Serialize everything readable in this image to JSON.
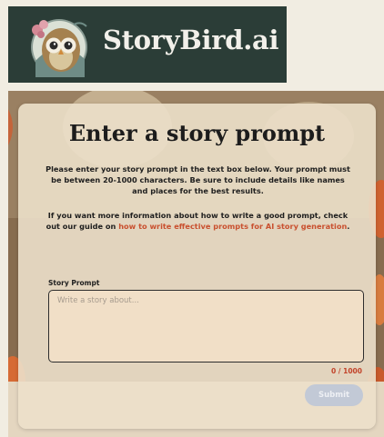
{
  "brand": {
    "name": "StoryBird.ai",
    "logo_icon": "owl-logo-icon",
    "bar_color": "#2b3d37"
  },
  "card": {
    "title": "Enter a story prompt",
    "description": "Please enter your story prompt in the text box below. Your prompt must be between 20-1000 characters. Be sure to include details like names and places for the best results.",
    "guide_prefix": "If you want more information about how to write a good prompt, check out our guide on",
    "guide_link": "how to write effective prompts for AI story generation",
    "guide_suffix": "."
  },
  "prompt_field": {
    "label": "Story Prompt",
    "placeholder": "Write a story about...",
    "value": "",
    "char_count": "0 / 1000"
  },
  "submit": {
    "label": "Submit",
    "color": "#c2c9d6"
  },
  "colors": {
    "accent": "#c9502f",
    "counter": "#c2432a",
    "card_bg": "#ece0ca"
  }
}
